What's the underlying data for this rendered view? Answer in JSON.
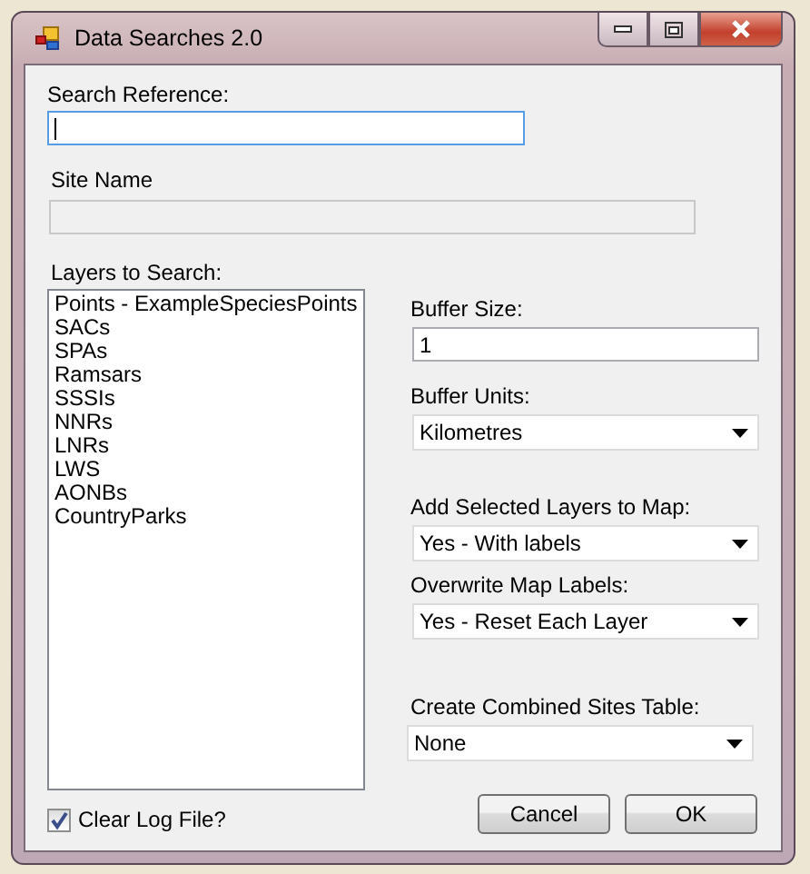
{
  "window": {
    "title": "Data Searches 2.0"
  },
  "search_reference": {
    "label": "Search Reference:",
    "focused": true
  },
  "site_name": {
    "label": "Site Name",
    "disabled": true
  },
  "layers": {
    "label": "Layers to Search:",
    "items": [
      "Points - ExampleSpeciesPoints",
      "SACs",
      "SPAs",
      "Ramsars",
      "SSSIs",
      "NNRs",
      "LNRs",
      "LWS",
      "AONBs",
      "CountryParks"
    ]
  },
  "buffer_size": {
    "label": "Buffer Size:",
    "value": "1"
  },
  "buffer_units": {
    "label": "Buffer Units:",
    "value": "Kilometres"
  },
  "add_layers": {
    "label": "Add Selected Layers to Map:",
    "value": "Yes - With labels"
  },
  "overwrite_labels": {
    "label": "Overwrite Map Labels:",
    "value": "Yes - Reset Each Layer"
  },
  "combined_table": {
    "label": "Create Combined Sites Table:",
    "value": "None"
  },
  "clear_log": {
    "label": "Clear Log File?",
    "checked": true
  },
  "buttons": [
    "Cancel",
    "OK"
  ]
}
